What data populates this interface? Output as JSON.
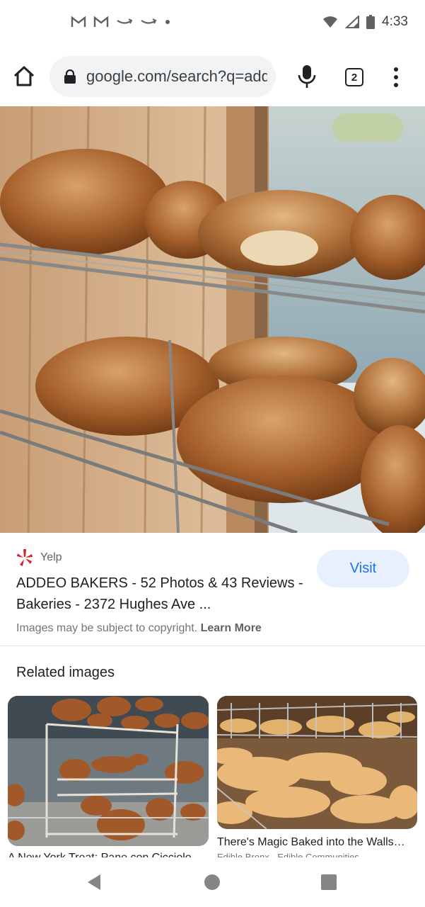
{
  "status_bar": {
    "time": "4:33"
  },
  "browser": {
    "url": "google.com/search?q=addeo+bakers",
    "tab_count": "2"
  },
  "result": {
    "source": "Yelp",
    "title": "ADDEO BAKERS - 52 Photos & 43 Reviews - Bakeries - 2372 Hughes Ave ...",
    "visit_label": "Visit",
    "copyright_text": "Images may be subject to copyright.",
    "learn_more": "Learn More"
  },
  "related": {
    "heading": "Related images",
    "items": [
      {
        "caption": "A New York Treat: Pane con Cicciolo",
        "source": ""
      },
      {
        "caption": "There's Magic Baked into the Walls…",
        "source": "Edible Bronx - Edible Communities"
      }
    ]
  },
  "colors": {
    "accent": "#1a73e8",
    "visit_bg": "#e8f0fe",
    "yelp": "#d32323"
  }
}
